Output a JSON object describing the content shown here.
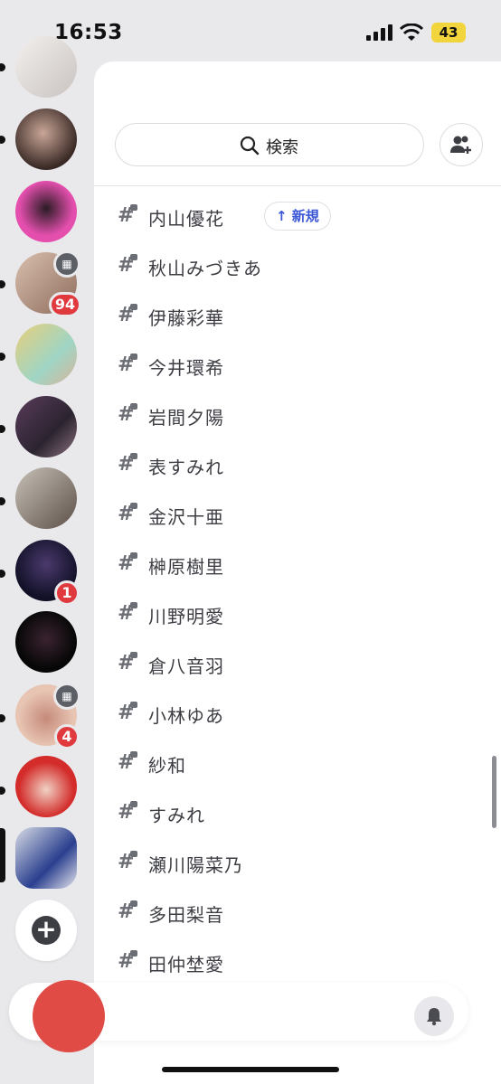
{
  "status_bar": {
    "time": "16:53",
    "battery": "43"
  },
  "search": {
    "label": "検索"
  },
  "new_pill": {
    "label": "↑ 新規"
  },
  "channels": [
    "内山優花",
    "秋山みづきあ",
    "伊藤彩華",
    "今井環希",
    "岩間夕陽",
    "表すみれ",
    "金沢十亜",
    "榊原樹里",
    "川野明愛",
    "倉八音羽",
    "小林ゆあ",
    "紗和",
    "すみれ",
    "瀬川陽菜乃",
    "多田梨音",
    "田仲埜愛"
  ],
  "rail_badges": {
    "b1": "94",
    "b2": "1",
    "b3": "4"
  },
  "colors": {
    "accent": "#3b57d6",
    "badge": "#e0393e",
    "battery": "#f2d53c"
  },
  "icons": {
    "hash": "#"
  }
}
